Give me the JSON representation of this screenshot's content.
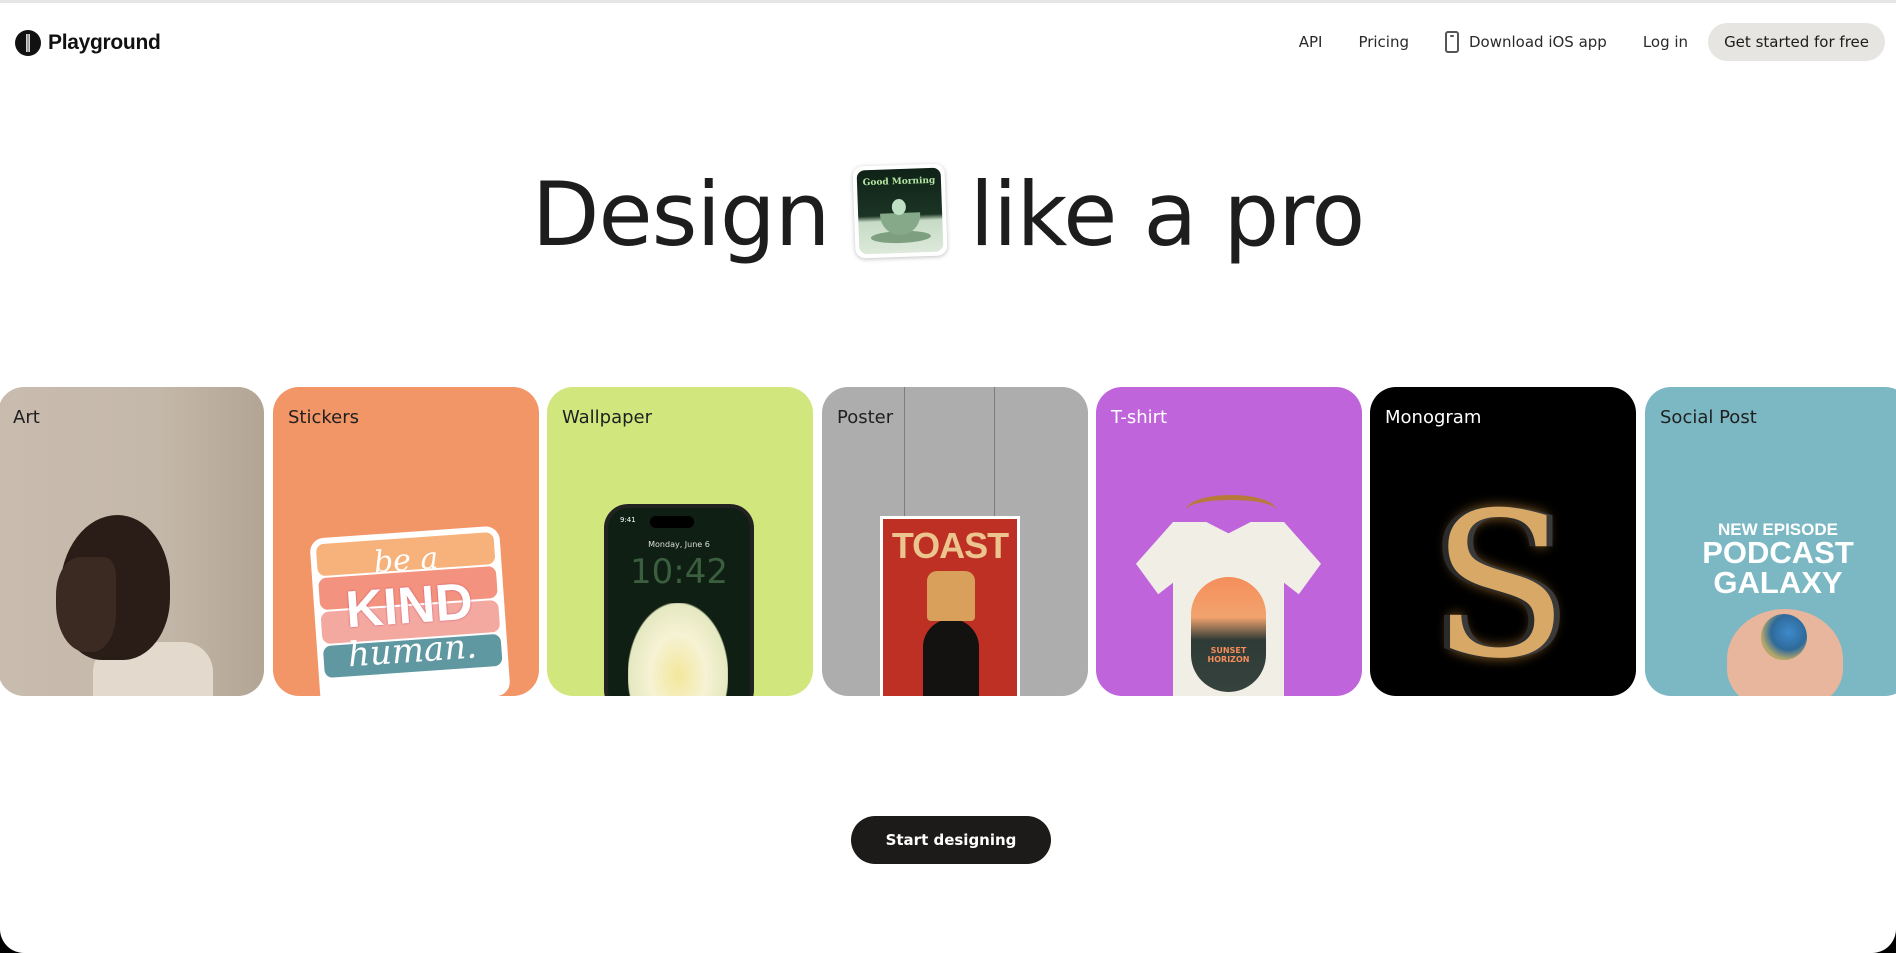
{
  "header": {
    "brand": "Playground",
    "nav": {
      "api": "API",
      "pricing": "Pricing",
      "download_ios": "Download iOS app",
      "login": "Log in",
      "cta": "Get started for free"
    },
    "icons": {
      "logo": "playground-logo-icon",
      "phone": "phone-icon"
    }
  },
  "hero": {
    "title_before": "Design",
    "title_after": "like a pro",
    "thumbnail_text": "Good Morning"
  },
  "categories": [
    {
      "label": "Art",
      "bg": "#c6b9ab"
    },
    {
      "label": "Stickers",
      "bg": "#f29668",
      "art": {
        "line1": "be a",
        "line2": "KIND",
        "line3": "human."
      }
    },
    {
      "label": "Wallpaper",
      "bg": "#d1e77e",
      "art": {
        "status_time": "9:41",
        "date": "Monday, June 6",
        "clock": "10:42"
      }
    },
    {
      "label": "Poster",
      "bg": "#adadad",
      "art": {
        "title": "TOAST"
      }
    },
    {
      "label": "T-shirt",
      "bg": "#c064dc",
      "art": {
        "line1": "SUNSET",
        "line2": "HORIZON"
      }
    },
    {
      "label": "Monogram",
      "bg": "#000000",
      "art": {
        "letter": "S"
      }
    },
    {
      "label": "Social Post",
      "bg": "#7bb8c4",
      "art": {
        "line1": "NEW EPISODE",
        "line2": "PODCAST",
        "line3": "GALAXY"
      }
    }
  ],
  "start_button": "Start designing"
}
